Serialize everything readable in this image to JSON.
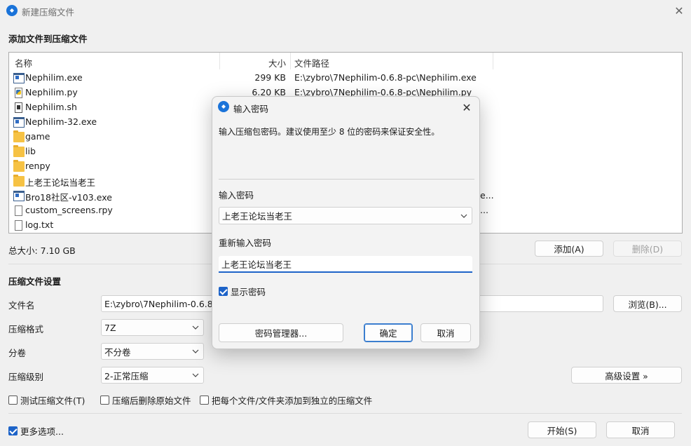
{
  "window": {
    "title": "新建压缩文件",
    "close_icon": "close-icon"
  },
  "add_files": {
    "section_title": "添加文件到压缩文件",
    "columns": [
      "名称",
      "大小",
      "文件路径"
    ],
    "rows": [
      {
        "name": "Nephilim.exe",
        "size": "299 KB",
        "path": "E:\\zybro\\7Nephilim-0.6.8-pc\\Nephilim.exe",
        "icon": "exe-icon"
      },
      {
        "name": "Nephilim.py",
        "size": "6.20 KB",
        "path": "E:\\zybro\\7Nephilim-0.6.8-pc\\Nephilim.py",
        "icon": "python-file-icon"
      },
      {
        "name": "Nephilim.sh",
        "size": "",
        "path": "",
        "icon": "shell-file-icon"
      },
      {
        "name": "Nephilim-32.exe",
        "size": "",
        "path": "",
        "icon": "exe-icon"
      },
      {
        "name": "game",
        "size": "",
        "path": "",
        "icon": "folder-icon"
      },
      {
        "name": "lib",
        "size": "",
        "path": "",
        "icon": "folder-icon"
      },
      {
        "name": "renpy",
        "size": "",
        "path": "",
        "icon": "folder-icon"
      },
      {
        "name": "上老王论坛当老王",
        "size": "",
        "path": "",
        "icon": "folder-icon"
      },
      {
        "name": "Bro18社区-v103.exe",
        "size": "",
        "path": "e...",
        "icon": "exe-icon"
      },
      {
        "name": "custom_screens.rpy",
        "size": "",
        "path": "...",
        "icon": "document-icon"
      },
      {
        "name": "log.txt",
        "size": "",
        "path": "",
        "icon": "document-icon"
      }
    ],
    "total_size": "总大小: 7.10 GB",
    "add_button": "添加(A)",
    "delete_button": "删除(D)"
  },
  "settings": {
    "section_title": "压缩文件设置",
    "filename_label": "文件名",
    "filename_value": "E:\\zybro\\7Nephilim-0.6.8-p",
    "browse_button": "浏览(B)...",
    "format_label": "压缩格式",
    "format_value": "7Z",
    "split_label": "分卷",
    "split_value": "不分卷",
    "level_label": "压缩级别",
    "level_value": "2-正常压缩",
    "advanced_button": "高级设置 »",
    "test_checkbox": "测试压缩文件(T)",
    "delete_after_checkbox": "压缩后删除原始文件",
    "separate_checkbox": "把每个文件/文件夹添加到独立的压缩文件",
    "more_options": "更多选项...",
    "start_button": "开始(S)",
    "cancel_button": "取消"
  },
  "password_dialog": {
    "title": "输入密码",
    "description": "输入压缩包密码。建议使用至少 8 位的密码来保证安全性。",
    "password_label": "输入密码",
    "password_value": "上老王论坛当老王",
    "confirm_label": "重新输入密码",
    "confirm_value": "上老王论坛当老王",
    "show_password": "显示密码",
    "manager_button": "密码管理器...",
    "ok_button": "确定",
    "cancel_button": "取消"
  },
  "colors": {
    "accent": "#1d63c8",
    "background": "#f0f0f0"
  }
}
